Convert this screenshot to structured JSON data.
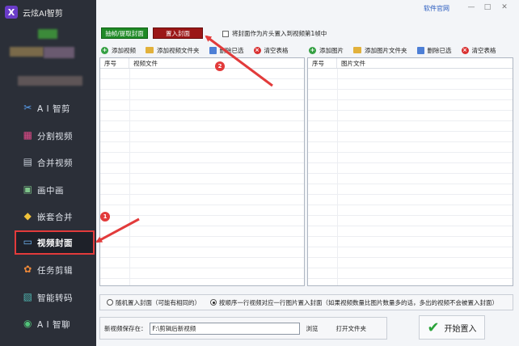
{
  "app": {
    "title": "云炫AI智剪",
    "logo_glyph": "X"
  },
  "topbar": {
    "website_link": "软件官网",
    "minimize": "—",
    "restore": "□",
    "close": "✕"
  },
  "sidebar": {
    "items": [
      {
        "label": "A I 智剪",
        "icon": "scissors-icon",
        "glyph": "✂"
      },
      {
        "label": "分割视频",
        "icon": "split-icon",
        "glyph": "▦"
      },
      {
        "label": "合并视频",
        "icon": "merge-icon",
        "glyph": "▤"
      },
      {
        "label": "画中画",
        "icon": "pip-icon",
        "glyph": "▣"
      },
      {
        "label": "嵌套合并",
        "icon": "nest-icon",
        "glyph": "◆"
      },
      {
        "label": "视频封面",
        "icon": "cover-icon",
        "glyph": "▭"
      },
      {
        "label": "任务剪辑",
        "icon": "task-icon",
        "glyph": "✿"
      },
      {
        "label": "智能转码",
        "icon": "transcode-icon",
        "glyph": "▧"
      },
      {
        "label": "A I 智聊",
        "icon": "chat-icon",
        "glyph": "◉"
      }
    ],
    "active_index": 5
  },
  "actions": {
    "extract_cover": "抽帧/提取封面",
    "insert_cover": "置入封面",
    "first_frame_checkbox": "将封面作为片头置入到视频第1帧中"
  },
  "left_toolbar": {
    "add_video": "添加视频",
    "add_video_folder": "添加视频文件夹",
    "delete_selected": "删除已选",
    "clear_table": "清空表格"
  },
  "right_toolbar": {
    "add_image": "添加图片",
    "add_image_folder": "添加图片文件夹",
    "delete_selected": "删除已选",
    "clear_table": "清空表格"
  },
  "video_table": {
    "columns": [
      "序号",
      "视频文件"
    ]
  },
  "image_table": {
    "columns": [
      "序号",
      "图片文件"
    ]
  },
  "options": {
    "random": "随机置入封面（可能有相同的）",
    "sequential": "按顺序一行视频对应一行图片置入封面（如果视频数量比图片数量多的话，多出的视频不会被置入封面）",
    "selected": "sequential"
  },
  "save": {
    "label": "新视频保存在：",
    "path": "F:\\剪辑后新视频",
    "browse": "浏览",
    "open_folder": "打开文件夹"
  },
  "start_button": "开始置入",
  "annotations": {
    "badge1": "1",
    "badge2": "2"
  },
  "colors": {
    "sidebar_bg": "#2b2f38",
    "accent_red": "#e23b3b",
    "green_button": "#1f8a26",
    "red_button": "#9b1717"
  }
}
